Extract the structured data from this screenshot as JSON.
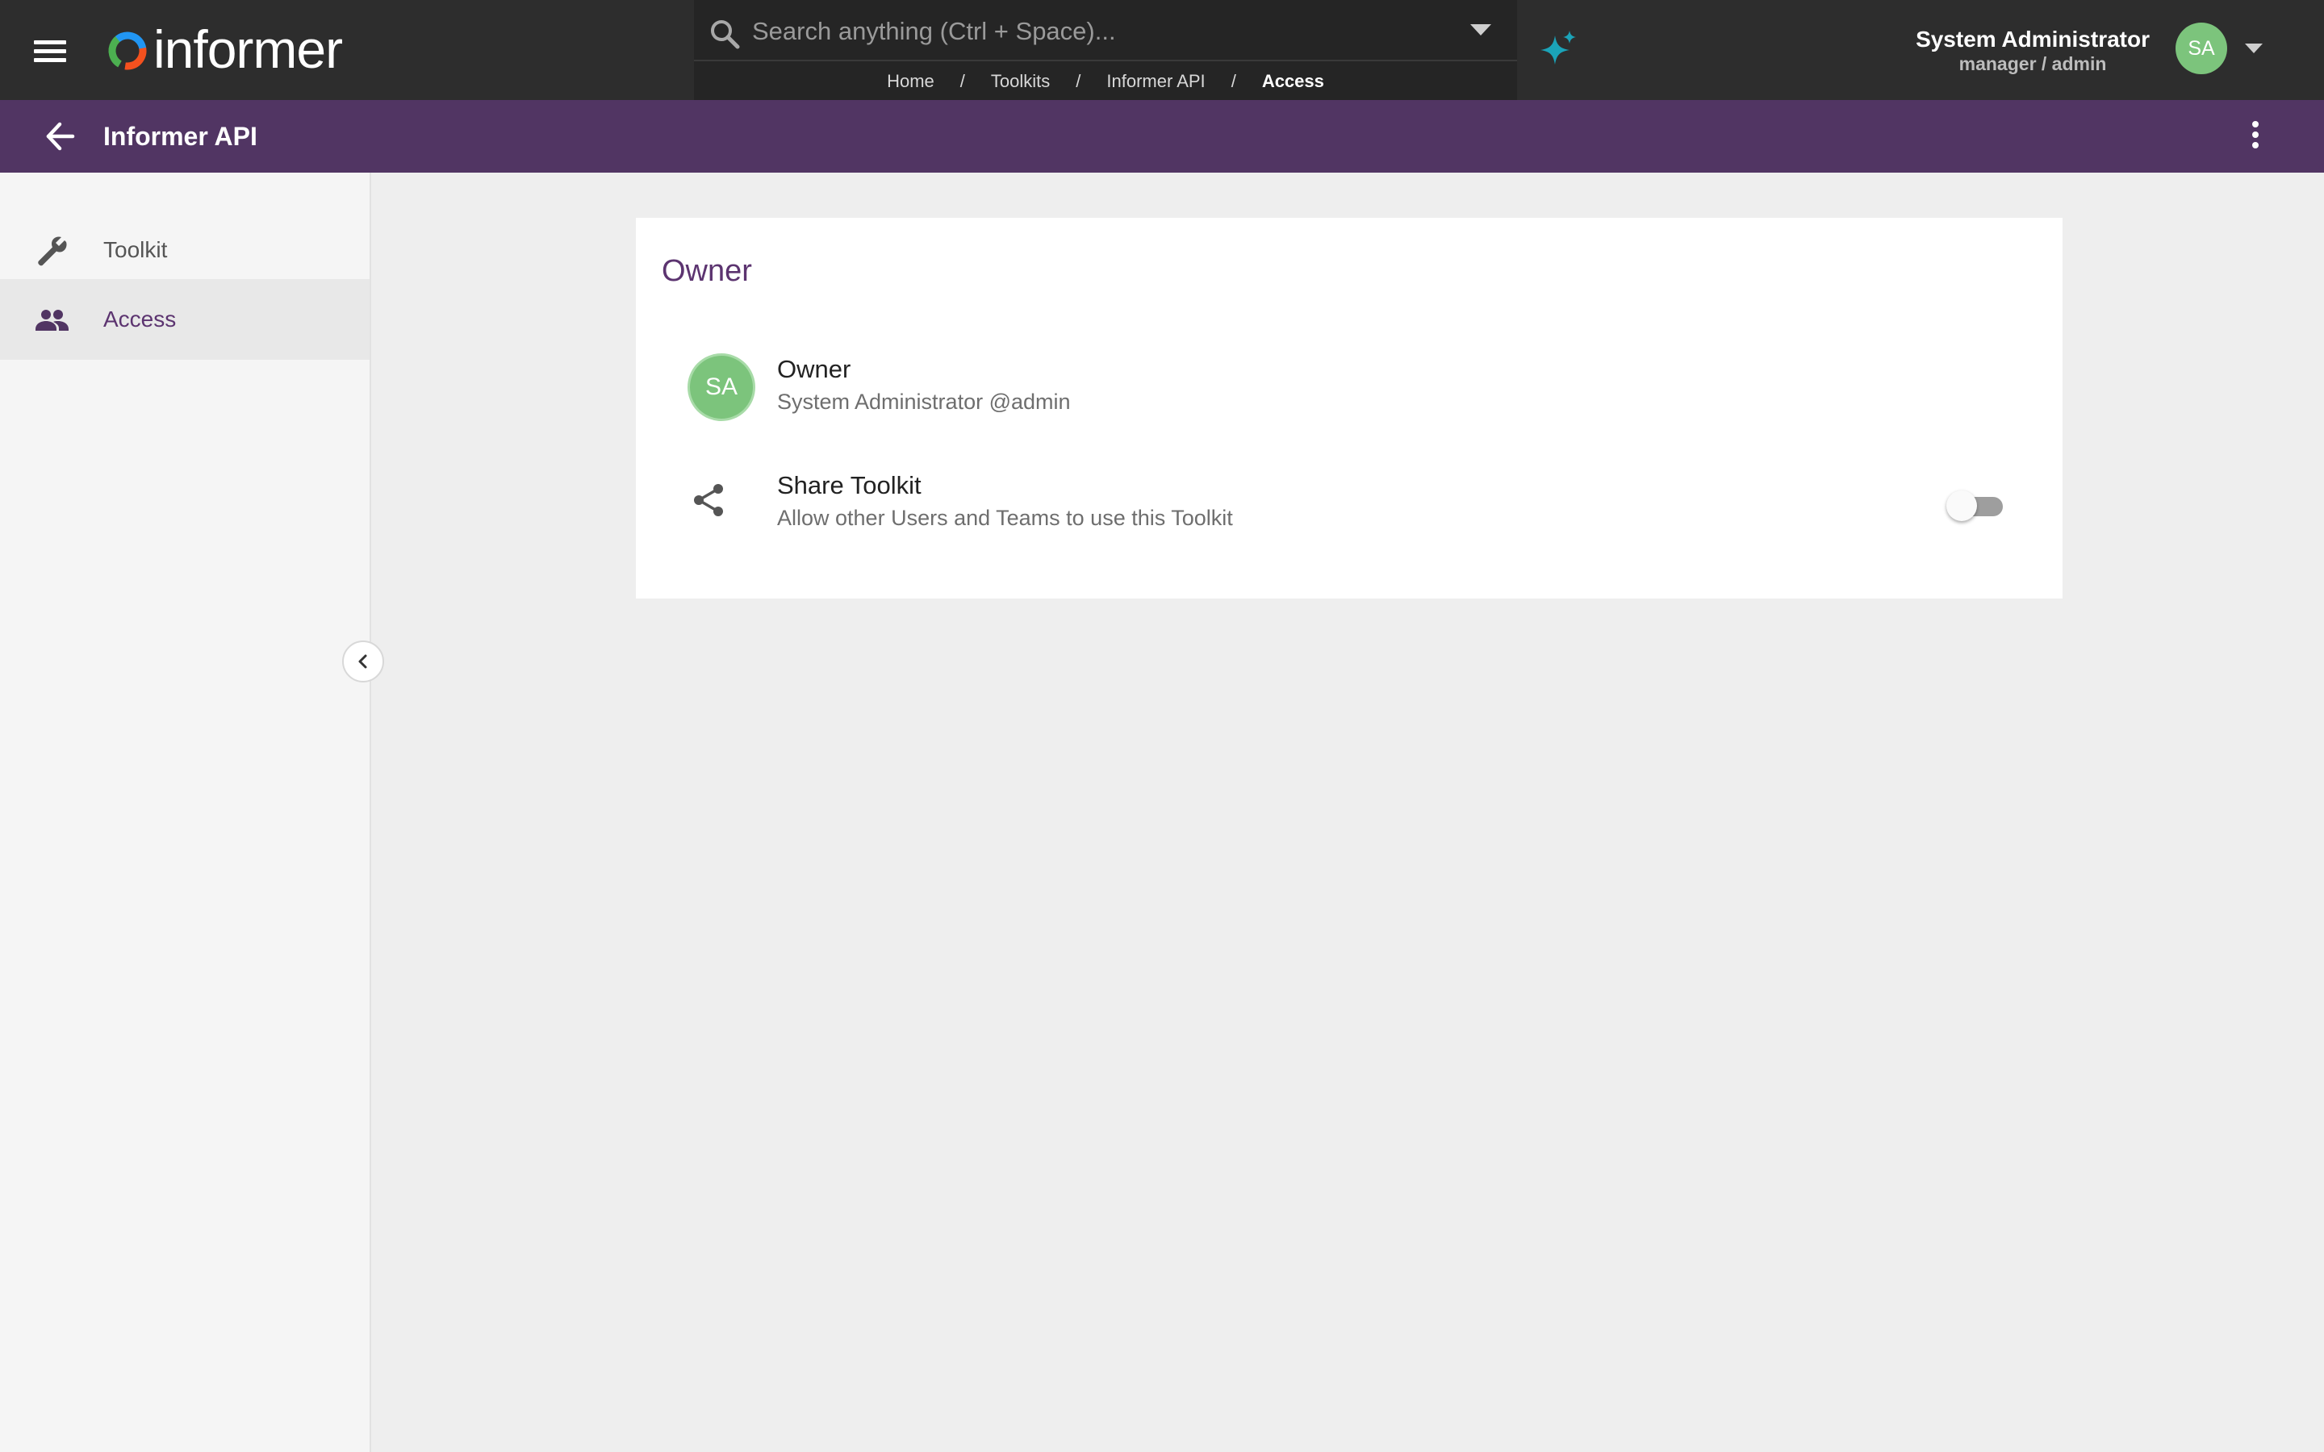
{
  "app": {
    "logo_text": "informer",
    "accent": "#513563",
    "avatar_color": "#7cc47c"
  },
  "search": {
    "placeholder": "Search anything (Ctrl + Space)...",
    "value": ""
  },
  "breadcrumb": {
    "items": [
      "Home",
      "Toolkits",
      "Informer API"
    ],
    "current": "Access",
    "separator": "/"
  },
  "user": {
    "name": "System Administrator",
    "role": "manager / admin",
    "initials": "SA"
  },
  "subheader": {
    "title": "Informer API"
  },
  "sidebar": {
    "items": [
      {
        "label": "Toolkit",
        "icon": "wrench-icon",
        "active": false
      },
      {
        "label": "Access",
        "icon": "people-icon",
        "active": true
      }
    ]
  },
  "card": {
    "title": "Owner",
    "owner": {
      "initials": "SA",
      "label": "Owner",
      "detail": "System Administrator @admin"
    },
    "share": {
      "label": "Share Toolkit",
      "description": "Allow other Users and Teams to use this Toolkit",
      "enabled": false
    }
  }
}
